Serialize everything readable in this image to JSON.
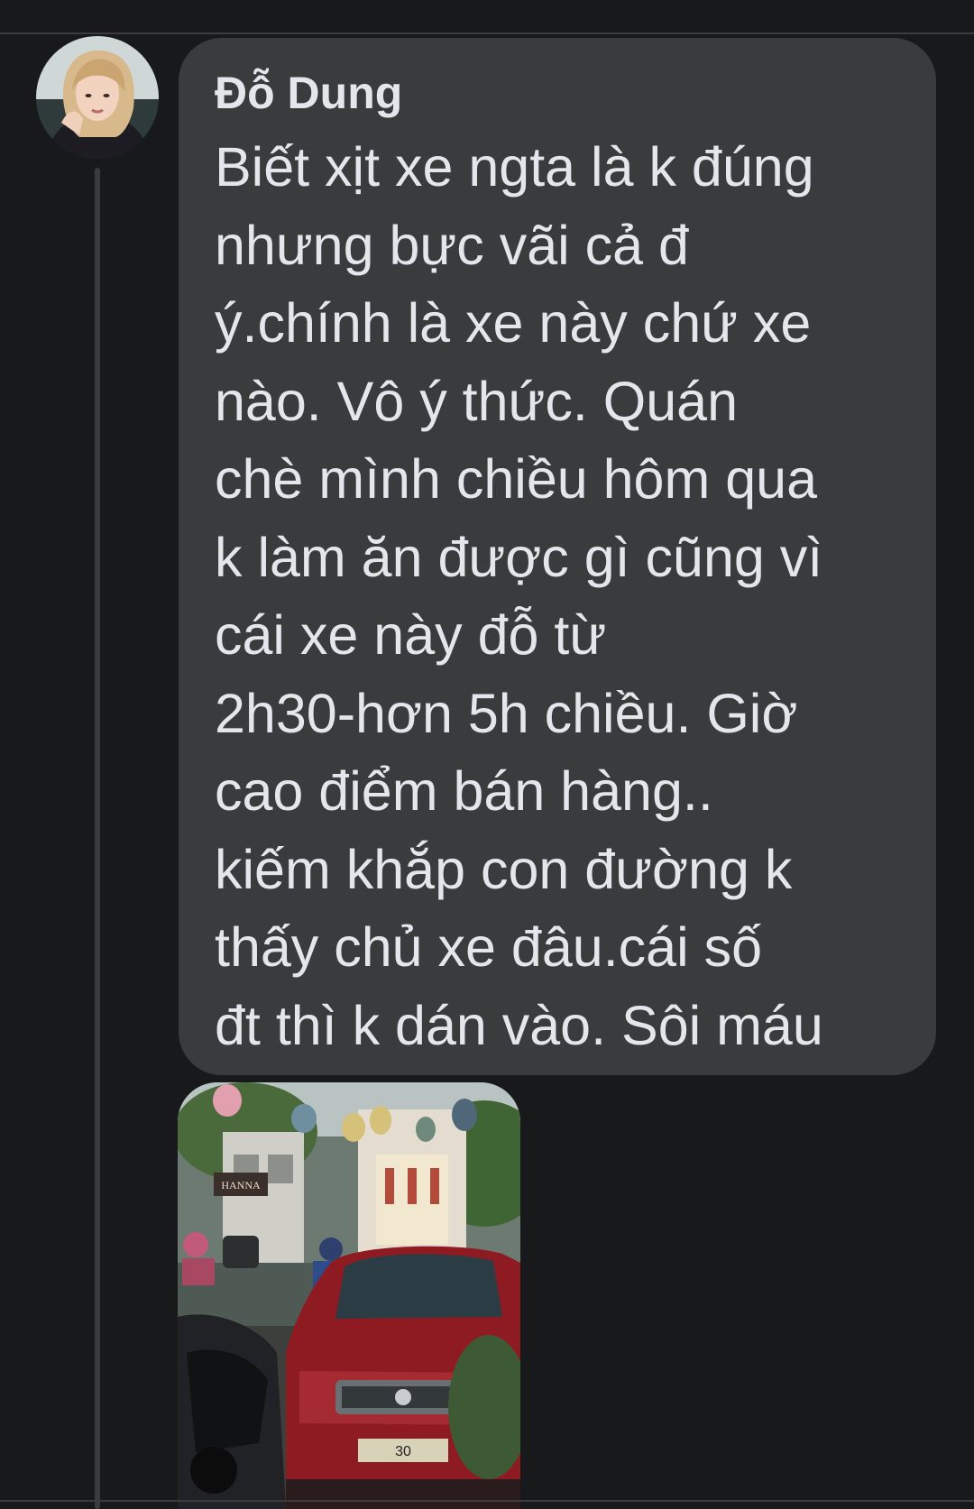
{
  "comment": {
    "author_name": "Đỗ Dung",
    "text": "Biết xịt xe ngta là k đúng\nnhưng bực vãi cả đ\ný.chính là xe này chứ xe\nnào. Vô ý thức.  Quán\nchè mình chiều hôm qua\nk làm ăn được gì cũng vì\ncái xe này đỗ từ\n2h30-hơn 5h chiều. Giờ\ncao điểm bán hàng..\nkiếm khắp con đường k\nthấy chủ xe đâu.cái số\nđt thì k dán vào. Sôi máu"
  },
  "photo": {
    "shop_sign_text": "HANNA",
    "plate_text": "30"
  },
  "colors": {
    "background": "#18191a",
    "bubble": "#3a3b3c",
    "text": "#e4e6eb",
    "car": "#8e1b22"
  }
}
